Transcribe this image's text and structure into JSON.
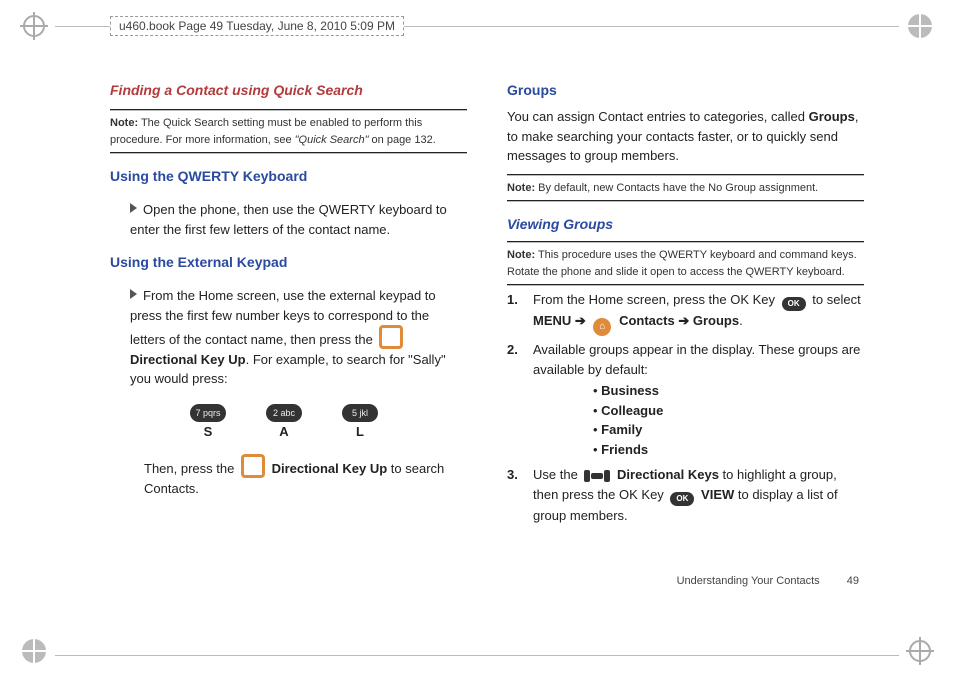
{
  "meta": {
    "page_tag": "u460.book  Page 49  Tuesday, June 8, 2010  5:09 PM"
  },
  "col1": {
    "h_finding": "Finding a Contact using Quick Search",
    "note1_label": "Note:",
    "note1": " The Quick Search setting must be enabled to perform this procedure. For more information, see ",
    "note1_ref": "\"Quick Search\"",
    "note1_tail": " on page 132.",
    "h_qwerty": "Using the QWERTY Keyboard",
    "qwerty_step": "Open the phone, then use the QWERTY keyboard to enter the first few letters of the contact name.",
    "h_ext": "Using the External Keypad",
    "ext_p1a": "From the Home screen, use the external keypad to press the first few number keys to correspond to the letters of the contact name, then press the ",
    "dir_up": "Directional Key Up",
    "ext_p1b": ". For example, to search for \"Sally\" you would press:",
    "keys": {
      "k1": "7 pqrs",
      "k2": "2 abc",
      "k3": "5 jkl",
      "l1": "S",
      "l2": "A",
      "l3": "L"
    },
    "ext_p2a": "Then, press the ",
    "ext_p2b": " to search Contacts."
  },
  "col2": {
    "h_groups": "Groups",
    "groups_intro_a": "You can assign Contact entries to categories, called ",
    "groups_bold": "Groups",
    "groups_intro_b": ", to make searching your contacts faster, or to quickly send messages to group members.",
    "note2_label": "Note:",
    "note2": " By default, new Contacts have the No Group assignment.",
    "h_viewing": "Viewing Groups",
    "note3_label": "Note:",
    "note3": " This procedure uses the QWERTY keyboard and command keys. Rotate the phone and slide it open to access the QWERTY keyboard.",
    "s1_num": "1.",
    "s1a": "From the Home screen, press the OK Key ",
    "s1b": " to select ",
    "menu": "MENU",
    "arrow": "➔",
    "contacts": "Contacts",
    "groups_word": "Groups",
    "period": ".",
    "s2_num": "2.",
    "s2": "Available groups appear in the display. These groups are available by default:",
    "g1": "Business",
    "g2": "Colleague",
    "g3": "Family",
    "g4": "Friends",
    "s3_num": "3.",
    "s3a": "Use the ",
    "dir_keys": "Directional Keys",
    "s3b": " to highlight a group, then press the OK Key ",
    "view": "VIEW",
    "s3c": " to display a list of group members."
  },
  "footer": {
    "section": "Understanding Your Contacts",
    "page": "49"
  }
}
